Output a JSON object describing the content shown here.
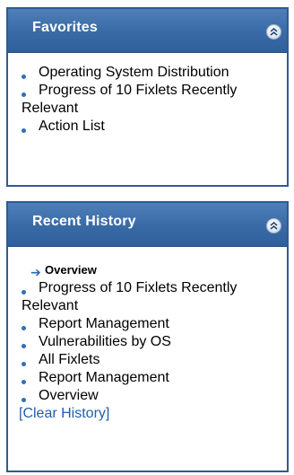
{
  "favorites": {
    "title": "Favorites",
    "items": [
      {
        "label": "Operating System Distribution"
      },
      {
        "label": "Progress of 10 Fixlets Recently Relevant"
      },
      {
        "label": "Action List"
      }
    ]
  },
  "history": {
    "title": "Recent History",
    "current": {
      "label": "Overview"
    },
    "items": [
      {
        "label": "Progress of 10 Fixlets Recently Relevant"
      },
      {
        "label": "Report Management"
      },
      {
        "label": "Vulnerabilities by OS"
      },
      {
        "label": "All Fixlets"
      },
      {
        "label": "Report Management"
      },
      {
        "label": "Overview"
      }
    ],
    "clear_label": "[Clear History]"
  },
  "icons": {
    "collapse": "chevron-double-up-icon",
    "bullet": "bullet-dot-icon",
    "current": "right-arrow-icon"
  },
  "colors": {
    "header": "#3a6aa6",
    "border": "#2f5b90",
    "link": "#1f5fb0"
  }
}
